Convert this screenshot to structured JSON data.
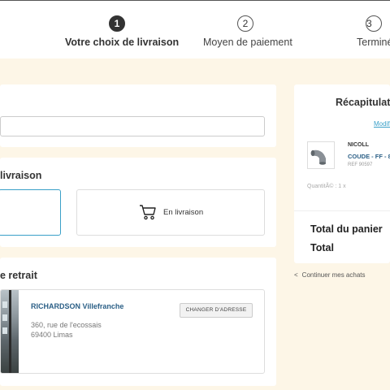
{
  "steps": [
    {
      "number": "1",
      "label": "Votre choix de livraison"
    },
    {
      "number": "2",
      "label": "Moyen de paiement"
    },
    {
      "number": "3",
      "label": "Terminé"
    }
  ],
  "delivery": {
    "section_title": "livraison",
    "option_delivery_label": "En livraison"
  },
  "pickup": {
    "section_title": "e retrait",
    "store_name": "RICHARDSON Villefranche",
    "address_line1": "360, rue de l'ecossais",
    "address_line2": "69400 Limas",
    "change_button": "CHANGER D'ADRESSE"
  },
  "summary": {
    "title": "Récapitulatio",
    "modify_link": "Modifi",
    "product": {
      "brand": "NICOLL",
      "name": "COUDE - FF - 8",
      "ref": "REF 90597",
      "quantity": "QuantitÃ© : 1 x"
    },
    "total_cart_label": "Total du panier",
    "total_label": "Total"
  },
  "continue_link": "Continuer mes achats",
  "icons": {
    "cart": "shopping-cart-icon",
    "back": "chevron-left-icon"
  },
  "colors": {
    "accent": "#3aa0c8",
    "link_dark": "#2b5f86",
    "background": "#fdf6e7"
  }
}
